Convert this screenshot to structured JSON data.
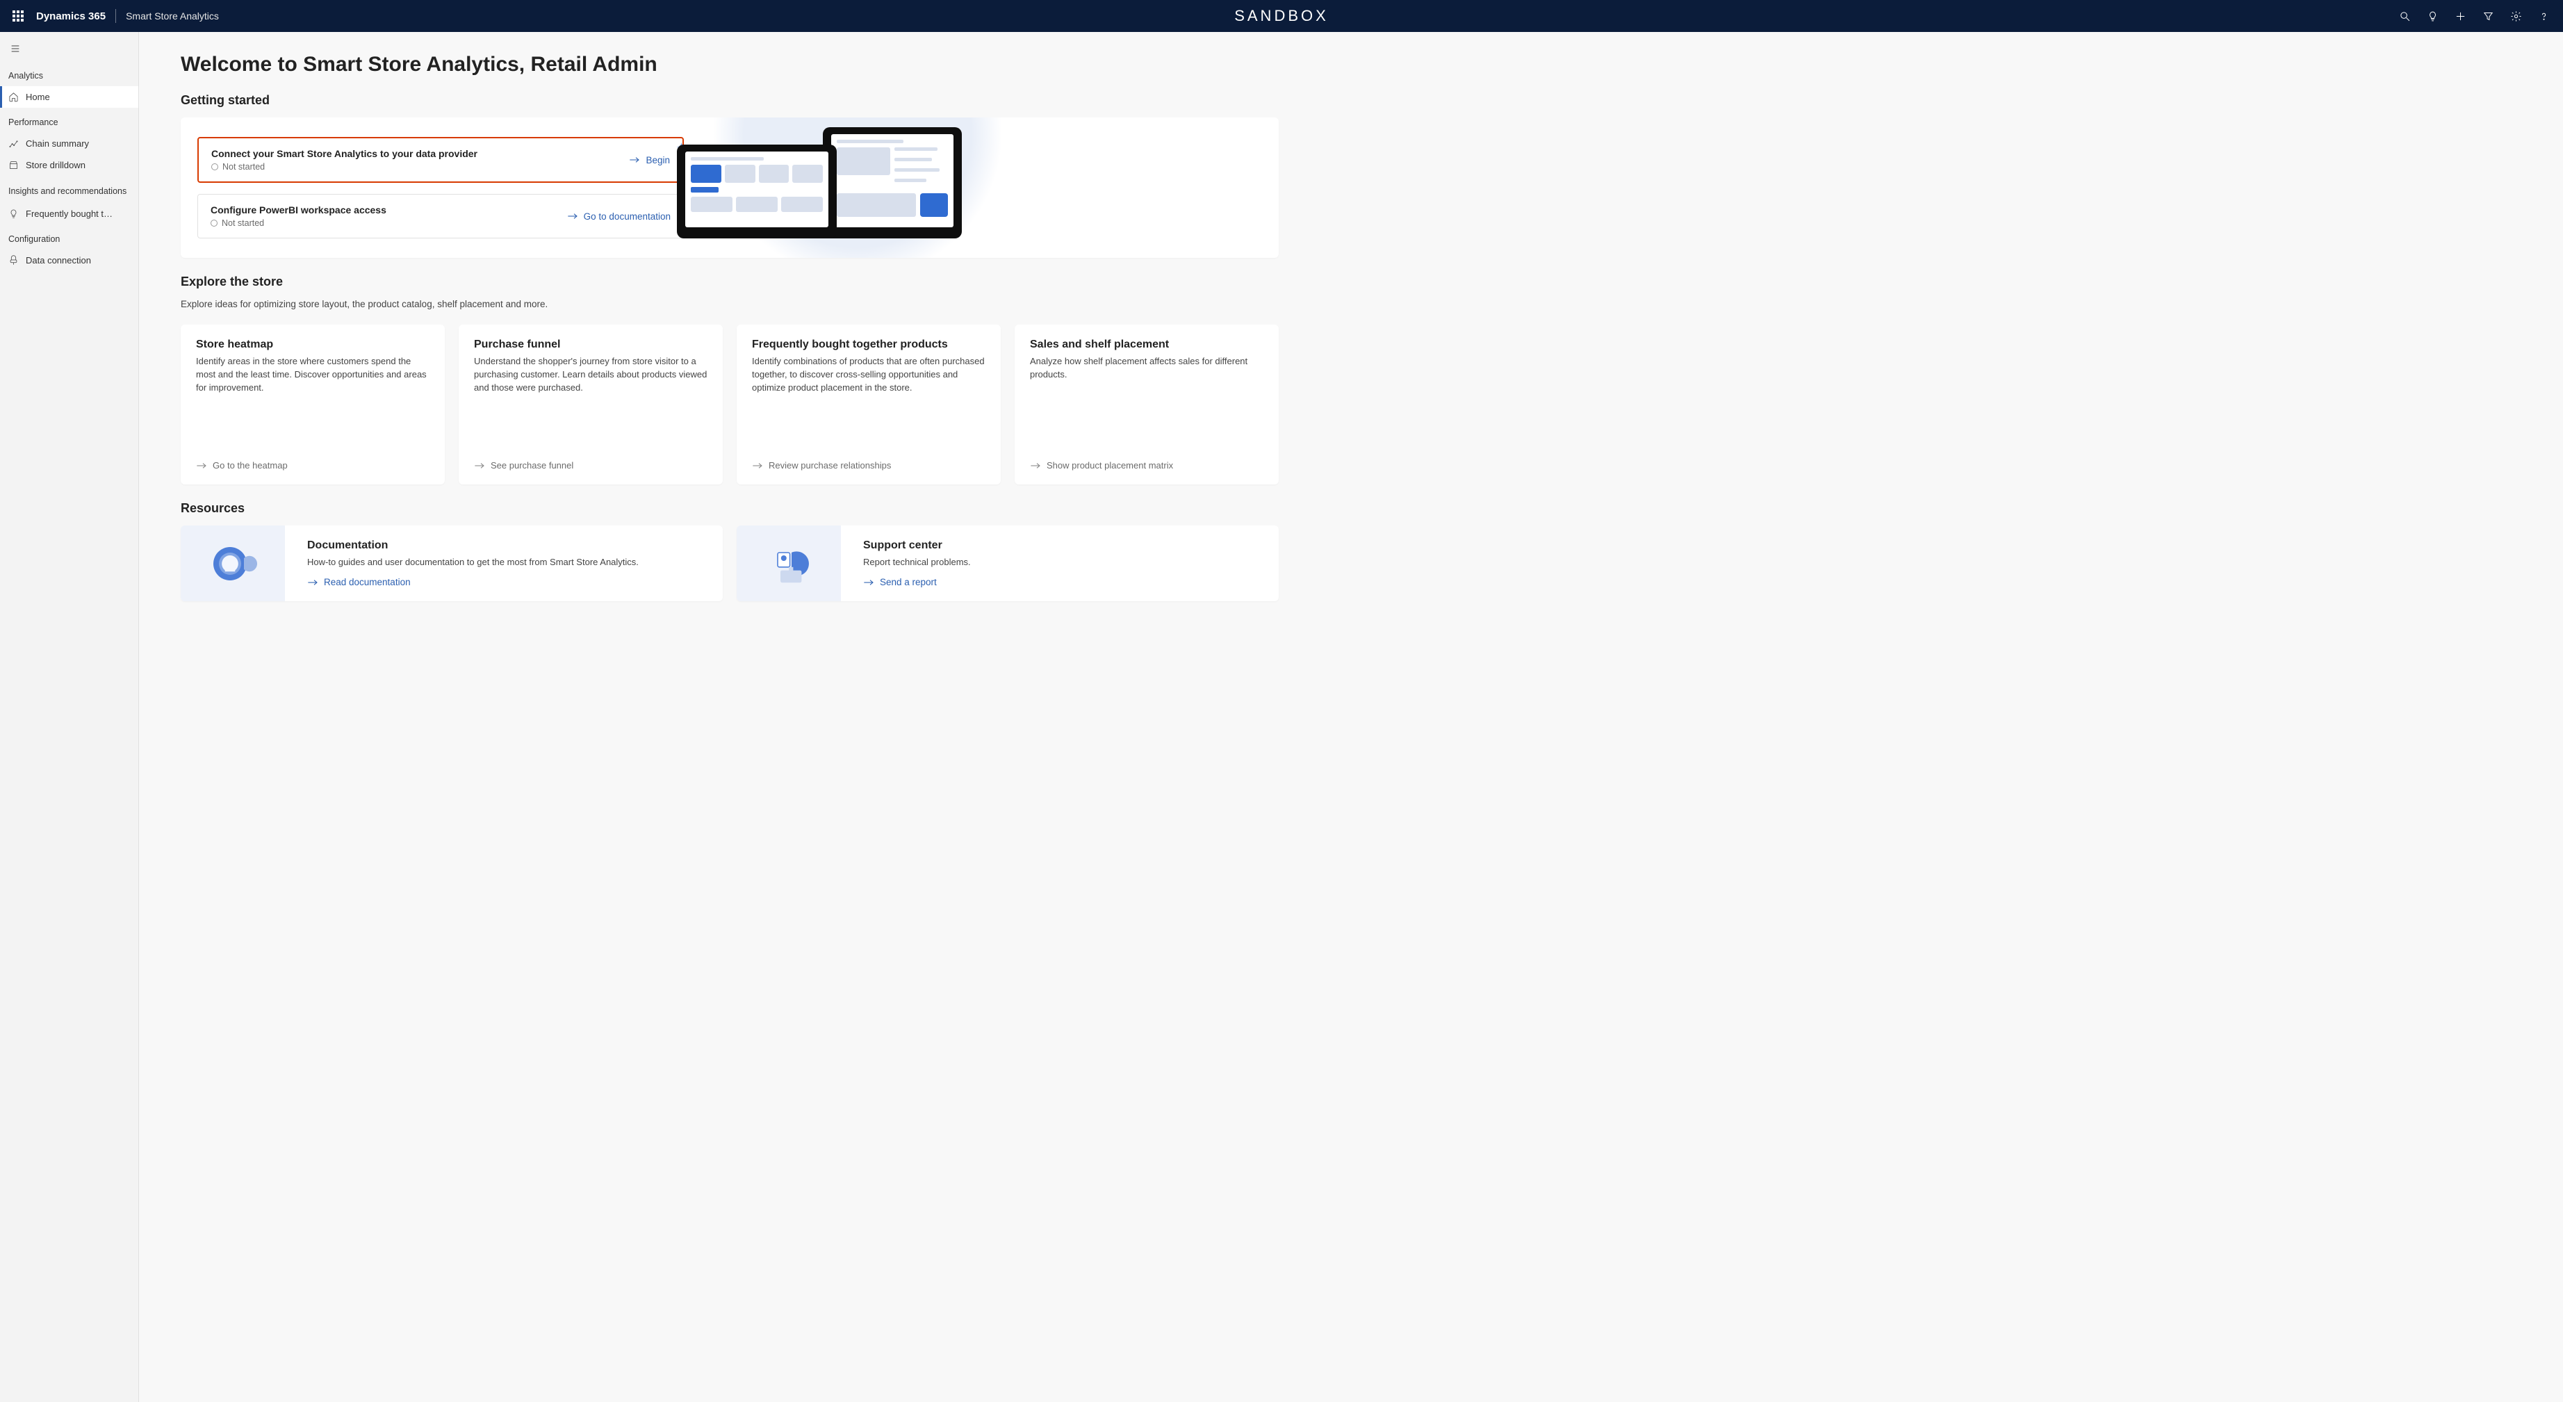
{
  "topbar": {
    "brand": "Dynamics 365",
    "app_name": "Smart Store Analytics",
    "environment_label": "SANDBOX"
  },
  "sidebar": {
    "sections": [
      {
        "label": "Analytics",
        "items": [
          {
            "label": "Home",
            "icon": "home",
            "active": true
          }
        ]
      },
      {
        "label": "Performance",
        "items": [
          {
            "label": "Chain summary",
            "icon": "chart"
          },
          {
            "label": "Store drilldown",
            "icon": "store"
          }
        ]
      },
      {
        "label": "Insights and recommendations",
        "items": [
          {
            "label": "Frequently bought t…",
            "icon": "bulb"
          }
        ]
      },
      {
        "label": "Configuration",
        "items": [
          {
            "label": "Data connection",
            "icon": "plug"
          }
        ]
      }
    ]
  },
  "page": {
    "title": "Welcome to Smart Store Analytics, Retail Admin",
    "getting_started_heading": "Getting started",
    "tasks": [
      {
        "title": "Connect your Smart Store Analytics to your data provider",
        "status": "Not started",
        "action": "Begin",
        "highlighted": true
      },
      {
        "title": "Configure PowerBI workspace access",
        "status": "Not started",
        "action": "Go to documentation",
        "highlighted": false
      }
    ],
    "explore": {
      "heading": "Explore the store",
      "subtitle": "Explore ideas for optimizing store layout, the product catalog, shelf placement and more.",
      "cards": [
        {
          "title": "Store heatmap",
          "desc": "Identify areas in the store where customers spend the most and the least time. Discover opportunities and areas for improvement.",
          "cta": "Go to the heatmap"
        },
        {
          "title": "Purchase funnel",
          "desc": "Understand the shopper's journey from store visitor to a purchasing customer. Learn details about products viewed and those were purchased.",
          "cta": "See purchase funnel"
        },
        {
          "title": "Frequently bought together products",
          "desc": "Identify combinations of products that are often purchased together, to discover cross-selling opportunities and optimize product placement in the store.",
          "cta": "Review purchase relationships"
        },
        {
          "title": "Sales and shelf placement",
          "desc": "Analyze how shelf placement affects sales for different products.",
          "cta": "Show product placement matrix"
        }
      ]
    },
    "resources": {
      "heading": "Resources",
      "cards": [
        {
          "title": "Documentation",
          "desc": "How-to guides and user documentation to get the most from Smart Store Analytics.",
          "cta": "Read documentation"
        },
        {
          "title": "Support center",
          "desc": "Report technical problems.",
          "cta": "Send a report"
        }
      ]
    }
  }
}
